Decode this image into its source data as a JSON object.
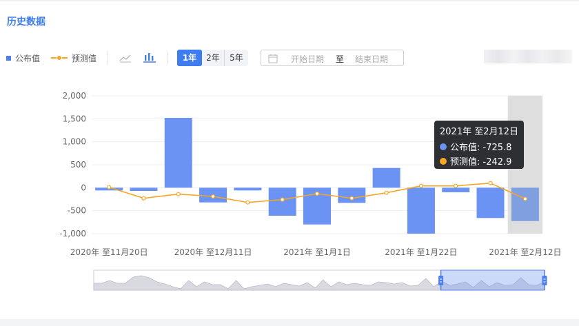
{
  "title": "历史数据",
  "legend": {
    "bar_label": "公布值",
    "line_label": "预测值"
  },
  "icons": {
    "line_chart": "line-chart-icon",
    "bar_chart": "bar-chart-icon",
    "calendar": "calendar-icon"
  },
  "range_buttons": [
    "1年",
    "2年",
    "5年"
  ],
  "selected_range": "1年",
  "date_range": {
    "start_placeholder": "开始日期",
    "separator": "至",
    "end_placeholder": "结束日期"
  },
  "colors": {
    "bar": "#6a93f3",
    "bar_highlight": "#7f9fe0",
    "line": "#f5a623",
    "accent": "#3e7cf0",
    "highlight_band": "#dedede",
    "tooltip_bg": "#2d2f33"
  },
  "tooltip": {
    "title": "2021年 至2月12日",
    "bar_text": "公布值: -725.8",
    "line_text": "预测值: -242.9"
  },
  "chart_data": {
    "type": "bar",
    "categories": [
      "",
      "",
      "",
      "",
      "",
      "",
      "",
      "",
      "",
      "",
      "",
      "",
      ""
    ],
    "x_tick_labels": [
      "2020年 至11月20日",
      "2020年 至12月11日",
      "2021年 至1月1日",
      "2021年 至1月22日",
      "2021年 至2月12日"
    ],
    "x_tick_positions": [
      0,
      3,
      6,
      9,
      12
    ],
    "series": [
      {
        "name": "公布值",
        "type": "bar",
        "values": [
          -60,
          -70,
          1520,
          -320,
          -60,
          -610,
          -800,
          -330,
          430,
          -1000,
          -100,
          -660,
          -725.8
        ]
      },
      {
        "name": "预测值",
        "type": "line",
        "values": [
          10,
          -230,
          -140,
          -190,
          -320,
          -260,
          -130,
          -230,
          -110,
          40,
          40,
          100,
          -242.9
        ]
      }
    ],
    "ylim": [
      -1000,
      2000
    ],
    "yticks": [
      "2,000",
      "1,500",
      "1,000",
      "500",
      "0",
      "-500",
      "-1,000"
    ],
    "ytick_values": [
      2000,
      1500,
      1000,
      500,
      0,
      -500,
      -1000
    ],
    "highlighted_index": 12,
    "grid": true,
    "legend_position": "top-left"
  },
  "slider": {
    "overview_values": [
      8,
      8,
      12,
      8,
      8,
      17,
      19,
      16,
      10,
      7,
      3,
      0,
      12,
      3,
      10,
      6,
      6,
      0,
      12,
      0,
      3,
      5,
      7,
      3,
      8,
      6,
      4,
      9,
      1,
      13,
      3,
      10,
      6,
      8,
      6,
      5,
      10,
      9,
      7,
      9,
      4,
      5,
      15,
      3,
      11,
      5,
      7,
      10,
      2,
      12,
      3,
      9,
      5,
      6,
      16,
      6,
      5,
      10
    ],
    "selection_start": 0.77,
    "selection_end": 1.0
  }
}
